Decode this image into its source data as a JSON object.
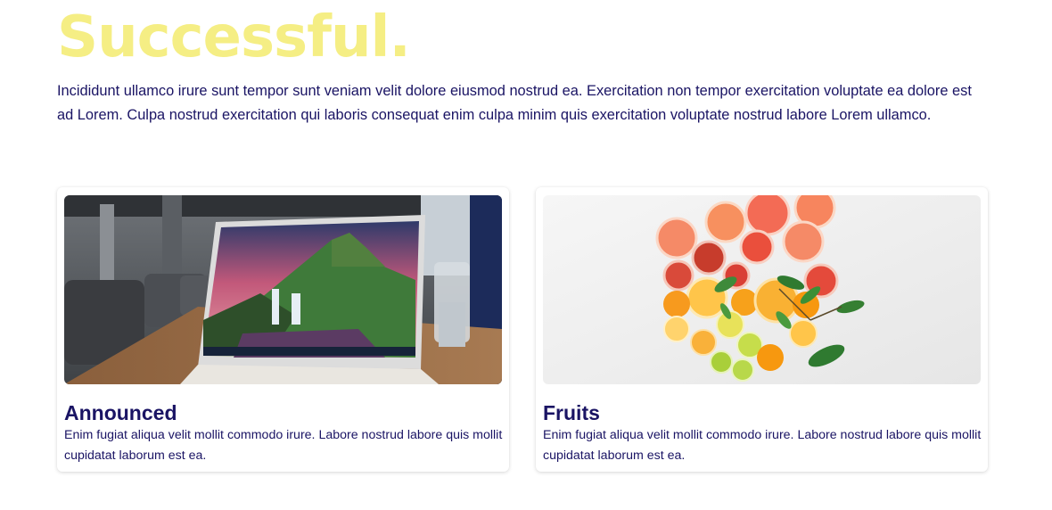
{
  "hero": {
    "title": "Successful.",
    "description": "Incididunt ullamco irure sunt tempor sunt veniam velit dolore eiusmod nostrud ea. Exercitation non tempor exercitation voluptate ea dolore est ad Lorem. Culpa nostrud exercitation qui laboris consequat enim culpa minim quis exercitation voluptate nostrud labore Lorem ullamco."
  },
  "cards": [
    {
      "image": "laptop-photo",
      "title": "Announced",
      "description": "Enim fugiat aliqua velit mollit commodo irure. Labore nostrud labore quis mollit cupidatat laborum est ea."
    },
    {
      "image": "citrus-fruits-photo",
      "title": "Fruits",
      "description": "Enim fugiat aliqua velit mollit commodo irure. Labore nostrud labore quis mollit cupidatat laborum est ea."
    }
  ],
  "colors": {
    "headline": "#f5ee84",
    "text": "#1a1464",
    "card_background": "#ffffff"
  }
}
